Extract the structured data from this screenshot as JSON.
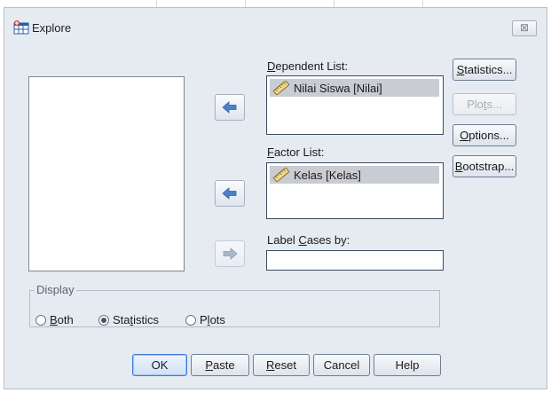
{
  "window": {
    "title": "Explore",
    "close_glyph": "⊠"
  },
  "labels": {
    "dependent_list": [
      "D",
      "ependent List:"
    ],
    "factor_list": [
      "F",
      "actor List:"
    ],
    "label_cases": [
      "Label ",
      "C",
      "ases by:"
    ]
  },
  "dependent_list": {
    "items": [
      "Nilai Siswa [Nilai]"
    ]
  },
  "factor_list": {
    "items": [
      "Kelas [Kelas]"
    ]
  },
  "label_cases_value": "",
  "side_buttons": {
    "statistics": [
      "S",
      "tatistics..."
    ],
    "plots": [
      "Plo",
      "t",
      "s..."
    ],
    "options": [
      "O",
      "ptions..."
    ],
    "bootstrap": [
      "B",
      "ootstrap..."
    ]
  },
  "display": {
    "legend": "Display",
    "both": [
      "B",
      "oth"
    ],
    "statistics": [
      "Sta",
      "t",
      "istics"
    ],
    "plots": [
      "P",
      "l",
      "ots"
    ],
    "selected": "statistics"
  },
  "bottom_buttons": {
    "ok": "OK",
    "paste": [
      "P",
      "aste"
    ],
    "reset": [
      "R",
      "eset"
    ],
    "cancel": "Cancel",
    "help": "Help"
  },
  "icons": {
    "app": "table-explore-icon",
    "variable": "ruler-scale-icon",
    "move_arrow": "arrow-left-icon",
    "move_arrow_disabled": "arrow-right-icon"
  },
  "colors": {
    "dialog_bg": "#e6eaf1",
    "selection": "#c9ccd2",
    "default_button_border": "#3b7ad8",
    "arrow_blue": "#4f7fc7"
  }
}
